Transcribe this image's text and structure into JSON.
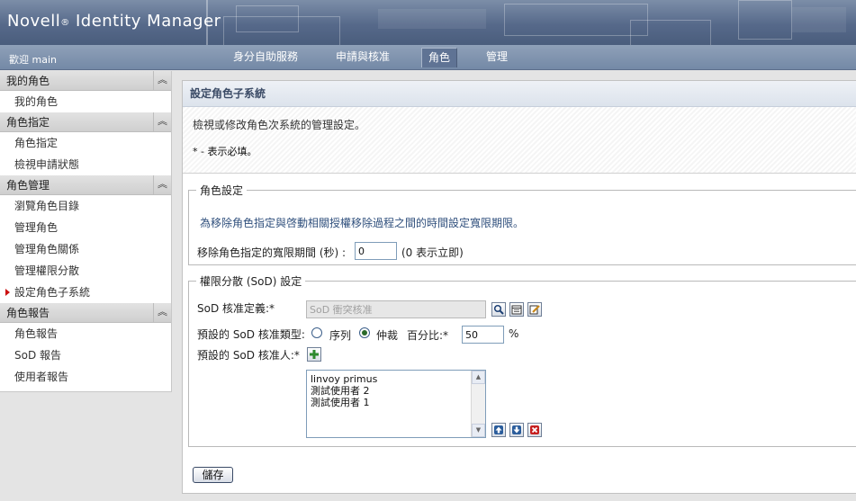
{
  "app": {
    "brand_name": "Novell",
    "brand_reg": "®",
    "brand_product": "Identity Manager",
    "welcome": "歡迎 main"
  },
  "nav": {
    "tabs": [
      {
        "label": "身分自助服務"
      },
      {
        "label": "申請與核准"
      },
      {
        "label": "角色",
        "active": true
      },
      {
        "label": "管理"
      }
    ]
  },
  "sidebar": {
    "collapse_glyph": "︽",
    "groups": [
      {
        "title": "我的角色",
        "items": [
          {
            "label": "我的角色"
          }
        ]
      },
      {
        "title": "角色指定",
        "items": [
          {
            "label": "角色指定"
          },
          {
            "label": "檢視申請狀態"
          }
        ]
      },
      {
        "title": "角色管理",
        "items": [
          {
            "label": "瀏覽角色目錄"
          },
          {
            "label": "管理角色"
          },
          {
            "label": "管理角色關係"
          },
          {
            "label": "管理權限分散"
          },
          {
            "label": "設定角色子系統",
            "current": true
          }
        ]
      },
      {
        "title": "角色報告",
        "items": [
          {
            "label": "角色報告"
          },
          {
            "label": "SoD 報告"
          },
          {
            "label": "使用者報告"
          }
        ]
      }
    ]
  },
  "main": {
    "title": "設定角色子系統",
    "description": "檢視或修改角色次系統的管理設定。",
    "required_note": "* - 表示必填。",
    "role_settings": {
      "legend": "角色設定",
      "help": "為移除角色指定與啓動相關授權移除過程之間的時間設定寬限期限。",
      "grace_label": "移除角色指定的寬限期間 (秒) :",
      "grace_value": "0",
      "grace_hint": "(0 表示立即)"
    },
    "sod_settings": {
      "legend": "權限分散 (SoD) 設定",
      "definition_label": "SoD 核准定義:*",
      "definition_value": "SoD 衝突核准",
      "type_label": "預設的 SoD 核准類型:",
      "type_serial": "序列",
      "type_quorum": "仲裁",
      "selected_type": "仲裁",
      "percent_label": "百分比:*",
      "percent_value": "50",
      "percent_unit": "%",
      "approvers_label": "預設的 SoD 核准人:*",
      "approvers": [
        "linvoy primus",
        "測試使用者 2",
        "測試使用者 1"
      ]
    },
    "save_label": "儲存"
  },
  "colors": {
    "banner": "#56698a",
    "navbar": "#7489a6",
    "panel_title": "#3b4b66",
    "help_text": "#2f4f7c",
    "current_marker": "#cc1111"
  },
  "icons": {
    "lookup": "magnifier-icon",
    "history": "history-icon",
    "edit": "edit-icon",
    "add": "plus-icon",
    "move_up": "arrow-up-icon",
    "move_down": "arrow-down-icon",
    "remove": "delete-icon"
  }
}
